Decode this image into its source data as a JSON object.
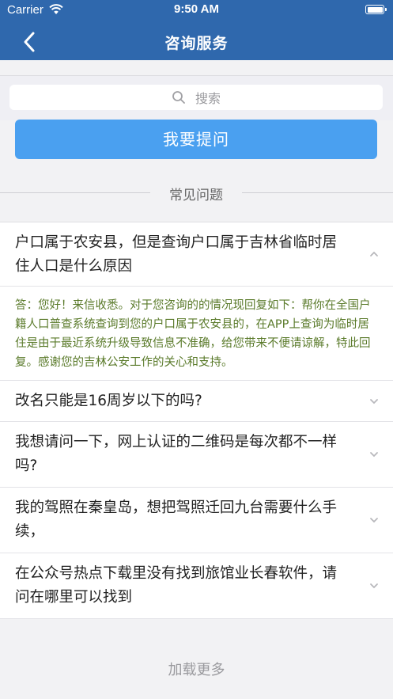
{
  "status_bar": {
    "carrier": "Carrier",
    "time": "9:50 AM"
  },
  "nav": {
    "title": "咨询服务"
  },
  "search": {
    "placeholder": "搜索"
  },
  "ask_button": "我要提问",
  "section_title": "常见问题",
  "faq": [
    {
      "question": "户口属于农安县，但是查询户口属于吉林省临时居住人口是什么原因",
      "expanded": true,
      "answer": "答：您好！来信收悉。对于您咨询的的情况现回复如下：帮你在全国户籍人口普查系统查询到您的户口属于农安县的，在APP上查询为临时居住是由于最近系统升级导致信息不准确，给您带来不便请谅解，特此回复。感谢您的吉林公安工作的关心和支持。"
    },
    {
      "question": "改名只能是16周岁以下的吗?",
      "expanded": false
    },
    {
      "question": "我想请问一下，网上认证的二维码是每次都不一样吗?",
      "expanded": false
    },
    {
      "question": "我的驾照在秦皇岛，想把驾照迁回九台需要什么手续，",
      "expanded": false
    },
    {
      "question": "在公众号热点下载里没有找到旅馆业长春软件，请问在哪里可以找到",
      "expanded": false
    }
  ],
  "load_more": "加载更多",
  "colors": {
    "nav_bg": "#2f68ad",
    "button_bg": "#4aa0f0",
    "answer_text": "#5a7a2a"
  }
}
